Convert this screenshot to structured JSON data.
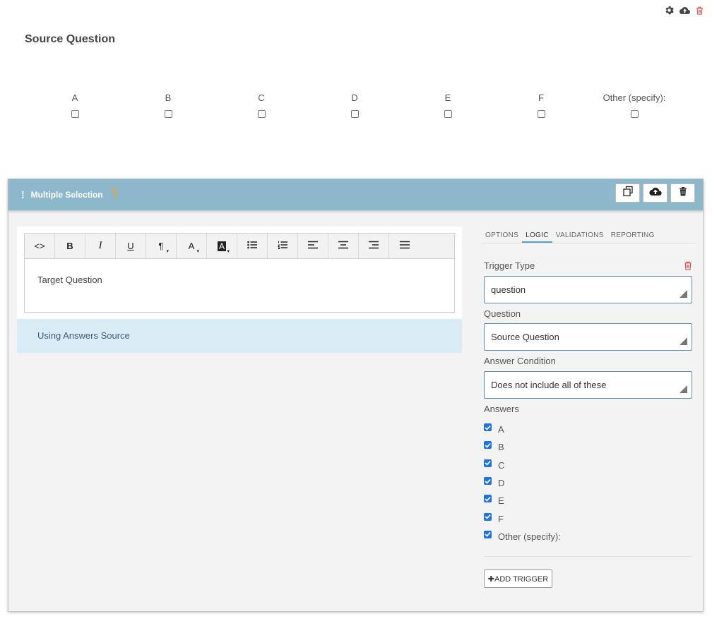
{
  "top_icons": [
    "gear-icon",
    "cloud-upload-icon",
    "trash-icon"
  ],
  "source_question": {
    "title": "Source Question",
    "options": [
      "A",
      "B",
      "C",
      "D",
      "E",
      "F",
      "Other (specify):"
    ]
  },
  "card": {
    "title": "Multiple Selection",
    "header_buttons": [
      "copy-icon",
      "cloud-upload-icon",
      "trash-icon"
    ]
  },
  "editor": {
    "toolbar": [
      {
        "name": "code-view",
        "glyph": "<>"
      },
      {
        "name": "bold",
        "glyph": "B"
      },
      {
        "name": "italic",
        "glyph": "I"
      },
      {
        "name": "underline",
        "glyph": "U"
      },
      {
        "name": "paragraph",
        "glyph": "¶"
      },
      {
        "name": "font-color",
        "glyph": "A"
      },
      {
        "name": "background-color",
        "glyph": "A"
      },
      {
        "name": "unordered-list",
        "glyph": ""
      },
      {
        "name": "ordered-list",
        "glyph": ""
      },
      {
        "name": "align-left",
        "glyph": ""
      },
      {
        "name": "align-center",
        "glyph": ""
      },
      {
        "name": "align-right",
        "glyph": ""
      },
      {
        "name": "justify",
        "glyph": ""
      }
    ],
    "content": "Target Question",
    "using_answers": "Using Answers Source"
  },
  "panel": {
    "tabs": [
      {
        "label": "OPTIONS",
        "active": false
      },
      {
        "label": "LOGIC",
        "active": true
      },
      {
        "label": "VALIDATIONS",
        "active": false
      },
      {
        "label": "REPORTING",
        "active": false
      }
    ],
    "trigger_type_label": "Trigger Type",
    "trigger_type_value": "question",
    "question_label": "Question",
    "question_value": "Source Question",
    "condition_label": "Answer Condition",
    "condition_value": "Does not include all of these",
    "answers_label": "Answers",
    "answers": [
      {
        "label": "A",
        "checked": true
      },
      {
        "label": "B",
        "checked": true
      },
      {
        "label": "C",
        "checked": true
      },
      {
        "label": "D",
        "checked": true
      },
      {
        "label": "E",
        "checked": true
      },
      {
        "label": "F",
        "checked": true
      },
      {
        "label": "Other (specify):",
        "checked": true
      }
    ],
    "add_trigger": "✚ADD TRIGGER"
  },
  "colors": {
    "header_bg": "#8db8cb",
    "using_bg": "#d9ebf5",
    "accent": "#5b9fc7",
    "checkbox": "#1a73e8",
    "delete": "#e05050",
    "branch": "#f0a030"
  }
}
